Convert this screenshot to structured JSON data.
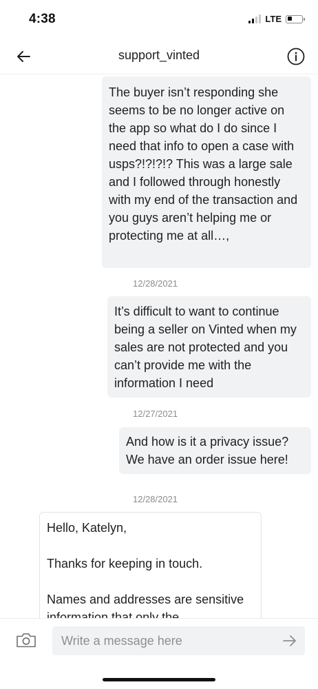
{
  "status_bar": {
    "time": "4:38",
    "network": "LTE",
    "battery_level": 0.3
  },
  "header": {
    "title": "support_vinted",
    "back_icon": "arrow-left-icon",
    "info_icon": "info-circle-icon"
  },
  "messages": [
    {
      "direction": "outgoing",
      "text": "The buyer isn’t responding she seems to be no longer active on the app so what do I do since I need that info to open a case with usps?!?!?!? This was a large sale and I followed through honestly with my end of the transaction and you guys aren’t helping me or protecting me at all…,"
    },
    {
      "type": "timestamp",
      "text": "12/28/2021"
    },
    {
      "direction": "outgoing",
      "text": "It’s difficult to want to continue being a seller on Vinted when my sales are not protected and you can’t provide me with the information I need"
    },
    {
      "type": "timestamp",
      "text": "12/27/2021"
    },
    {
      "direction": "outgoing",
      "text": "And how is it a privacy issue? We have an order issue here!"
    },
    {
      "type": "timestamp",
      "text": "12/28/2021"
    },
    {
      "direction": "incoming",
      "paragraphs": [
        "Hello, Katelyn,",
        "Thanks for keeping in touch.",
        "Names and addresses are sensitive information that only the"
      ]
    }
  ],
  "composer": {
    "placeholder": "Write a message here",
    "camera_icon": "camera-icon",
    "send_icon": "arrow-right-icon"
  }
}
